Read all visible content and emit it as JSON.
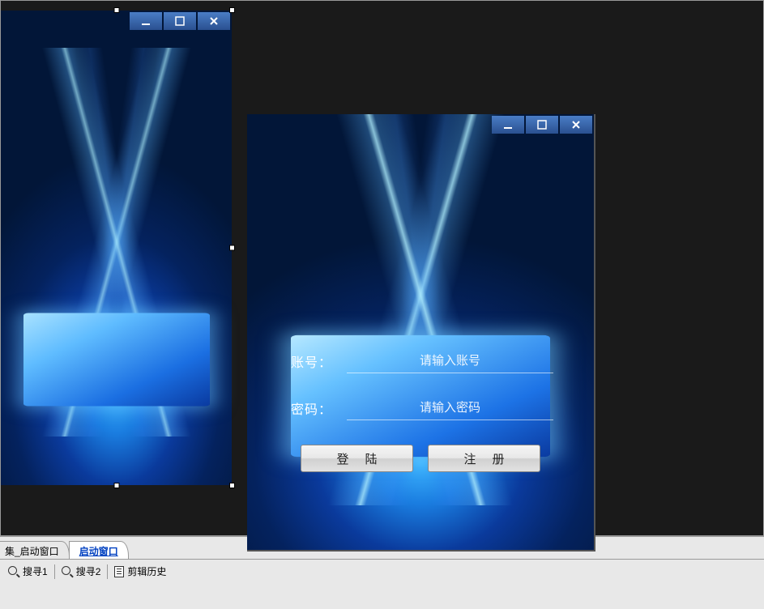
{
  "tabs": {
    "inactive": "集_启动窗口",
    "active": "启动窗口"
  },
  "statusbar": {
    "search1": "搜寻1",
    "search2": "搜寻2",
    "clipboard_history": "剪辑历史"
  },
  "login": {
    "account_label": "账号：",
    "account_placeholder": "请输入账号",
    "password_label": "密码：",
    "password_placeholder": "请输入密码",
    "login_button": "登陆",
    "register_button": "注册"
  }
}
